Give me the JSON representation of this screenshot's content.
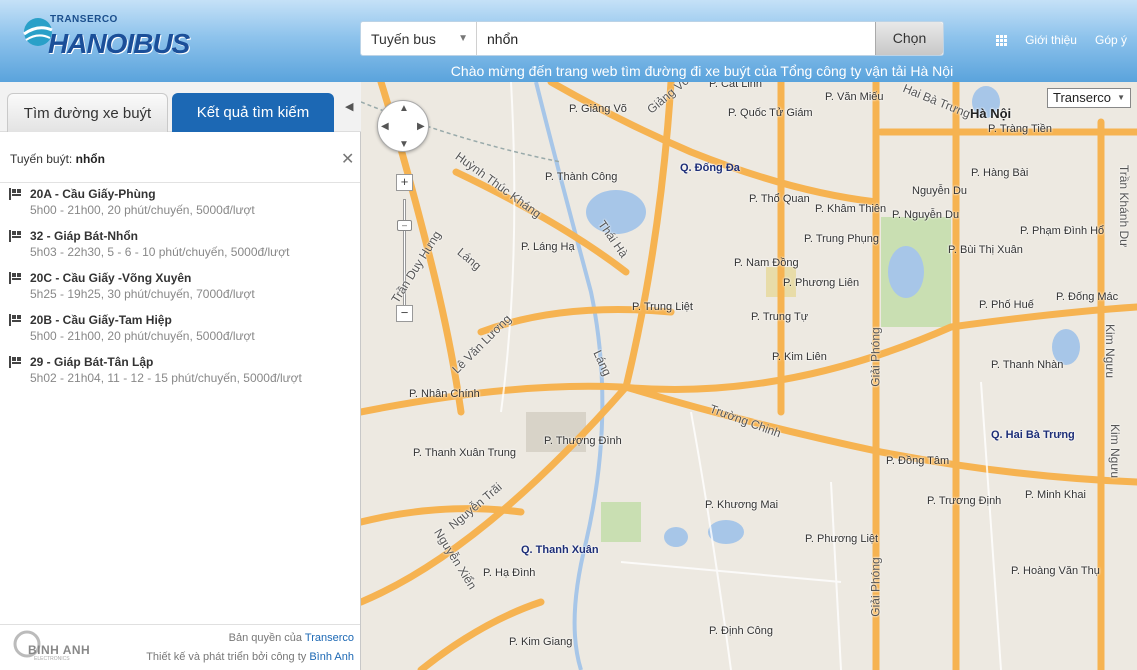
{
  "header": {
    "logo_small": "TRANSERCO",
    "logo_big": "HANOIBUS",
    "search_type": "Tuyến bus",
    "search_value": "nhổn",
    "search_button": "Chọn",
    "welcome": "Chào mừng đến trang web tìm đường đi xe buýt của Tổng công ty vận tải Hà Nội",
    "nav_about": "Giới thiệu",
    "nav_feedback": "Góp ý"
  },
  "sidebar": {
    "tab_find": "Tìm đường xe buýt",
    "tab_results": "Kết quả tìm kiếm",
    "route_prefix": "Tuyến buýt:",
    "route_query": "nhổn",
    "results": [
      {
        "title": "20A - Cầu Giấy-Phùng",
        "sub": "5h00 - 21h00, 20 phút/chuyến, 5000đ/lượt"
      },
      {
        "title": "32 - Giáp Bát-Nhổn",
        "sub": "5h03 - 22h30, 5 - 6 - 10 phút/chuyến, 5000đ/lượt"
      },
      {
        "title": "20C - Cầu Giấy -Võng Xuyên",
        "sub": "5h25 - 19h25, 30 phút/chuyến, 7000đ/lượt"
      },
      {
        "title": "20B - Cầu Giấy-Tam Hiệp",
        "sub": "5h00 - 21h00, 20 phút/chuyến, 5000đ/lượt"
      },
      {
        "title": "29 - Giáp Bát-Tân Lập",
        "sub": "5h02 - 21h04, 11 - 12 - 15 phút/chuyến, 5000đ/lượt"
      }
    ],
    "footer_copyright_prefix": "Bản quyền của",
    "footer_copyright_link": "Transerco",
    "footer_design_prefix": "Thiết kế và phát triển bởi công ty",
    "footer_design_link": "Bình Anh",
    "footer_logo_name": "BINH ANH",
    "footer_logo_sub": "ELECTRONICS"
  },
  "map": {
    "map_type": "Transerco",
    "labels": {
      "cat_linh": "P. Cát Linh",
      "giang_vo": "P. Giảng Võ",
      "van_mieu": "P. Văn Miếu",
      "quoc_tu_giam": "P. Quốc Tử Giám",
      "ha_noi": "Hà Nội",
      "trang_tien": "P. Tràng Tiền",
      "dong_da": "Q. Đống Đa",
      "thanh_cong": "P. Thành Công",
      "hang_bai": "P. Hàng Bài",
      "tho_quan": "P. Thổ Quan",
      "kham_thien": "P. Khâm Thiên",
      "nguyen_du": "P. Nguyễn Du",
      "nguyen_du_road": "Nguyễn Du",
      "lang_ha": "P. Láng Hạ",
      "trung_phung": "P. Trung Phụng",
      "pham_dinh_ho": "P. Phạm Đình Hổ",
      "bui_thi_xuan": "P. Bùi Thị Xuân",
      "nam_dong": "P. Nam Đồng",
      "phuong_lien": "P. Phương Liên",
      "trung_liet": "P. Trung Liệt",
      "pho_hue": "P. Phố Huế",
      "dong_mac": "P. Đống Mác",
      "trung_tu": "P. Trung Tự",
      "kim_lien": "P. Kim Liên",
      "thanh_nhan": "P. Thanh Nhàn",
      "nhan_chinh": "P. Nhân Chính",
      "thuong_dinh": "P. Thượng Đình",
      "hai_ba_trung": "Q. Hai Bà Trưng",
      "thanh_xuan_trung": "P. Thanh Xuân Trung",
      "dong_tam": "P. Đồng Tâm",
      "truong_dinh": "P. Trương Định",
      "minh_khai": "P. Minh Khai",
      "khuong_mai": "P. Khương Mai",
      "thanh_xuan": "Q. Thanh Xuân",
      "phuong_liet": "P. Phương Liệt",
      "ha_dinh": "P. Hạ Đình",
      "hoang_van_thu": "P. Hoàng Văn Thụ",
      "kim_giang": "P. Kim Giang",
      "dinh_cong": "P. Định Công",
      "huynh_thuc_khang": "Huỳnh Thúc Kháng",
      "thai_ha": "Thái Hà",
      "lang": "Láng",
      "lang2": "Láng",
      "tran_duy_hung": "Trần Duy Hưng",
      "le_van_luong": "Lê Văn Lương",
      "truong_chinh": "Trường Chinh",
      "nguyen_trai": "Nguyễn Trãi",
      "nguyen_xien": "Nguyễn Xiển",
      "giai_phong": "Giải Phóng",
      "giai_phong2": "Giải Phóng",
      "giang_vo_road": "Giảng Võ",
      "kim_nguu": "Kim Ngưu",
      "kim_nguu2": "Kim Ngưu",
      "tran_khanh_du": "Trần Khánh Dư",
      "hai_ba_trung_road": "Hai Bà Trưng"
    }
  }
}
